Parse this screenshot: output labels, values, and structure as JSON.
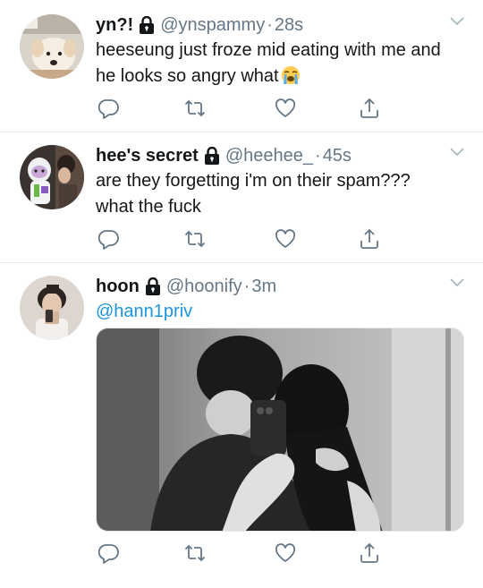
{
  "tweets": [
    {
      "name": "yn?!",
      "handle": "@ynspammy",
      "time": "28s",
      "text": "heeseung just froze mid eating with me and he looks so angry what",
      "emoji": "loudly-crying-face"
    },
    {
      "name": "hee's secret",
      "handle": "@heehee_",
      "time": "45s",
      "text_line1": "are they forgetting i'm on their spam???",
      "text_line2": "what the fuck"
    },
    {
      "name": "hoon",
      "handle": "@hoonify",
      "time": "3m",
      "mention": "@hann1priv"
    }
  ],
  "dot": "·",
  "icons": [
    "lock-icon",
    "chevron-down-icon",
    "reply-icon",
    "retweet-icon",
    "like-icon",
    "share-icon"
  ],
  "colors": {
    "text": "#14171a",
    "secondary": "#657786",
    "link": "#1b95e0",
    "divider": "#e1e8ed"
  }
}
